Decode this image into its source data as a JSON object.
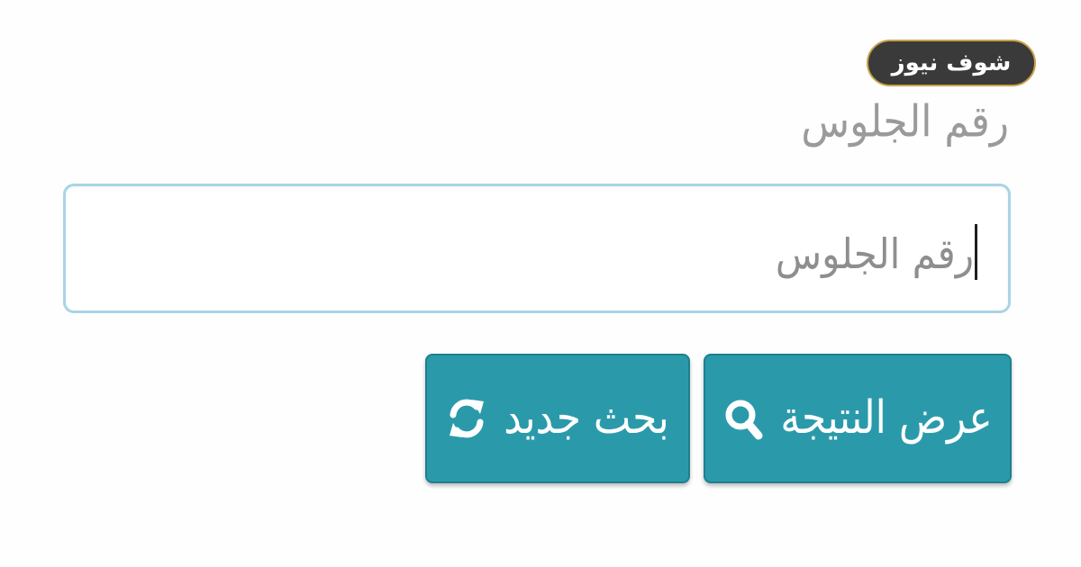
{
  "watermark": {
    "text": "شوف نيوز",
    "background": "#3a3a3a",
    "border_color": "#c9a24a"
  },
  "form": {
    "label": "رقم الجلوس",
    "input": {
      "value": "",
      "placeholder": "رقم الجلوس"
    },
    "buttons": [
      {
        "label": "عرض النتيجة",
        "icon": "search-icon"
      },
      {
        "label": "بحث جديد",
        "icon": "refresh-icon"
      }
    ]
  },
  "colors": {
    "button": "#2a9aab",
    "input_border": "#a9d4e6",
    "label_text": "#9a9a9a"
  }
}
